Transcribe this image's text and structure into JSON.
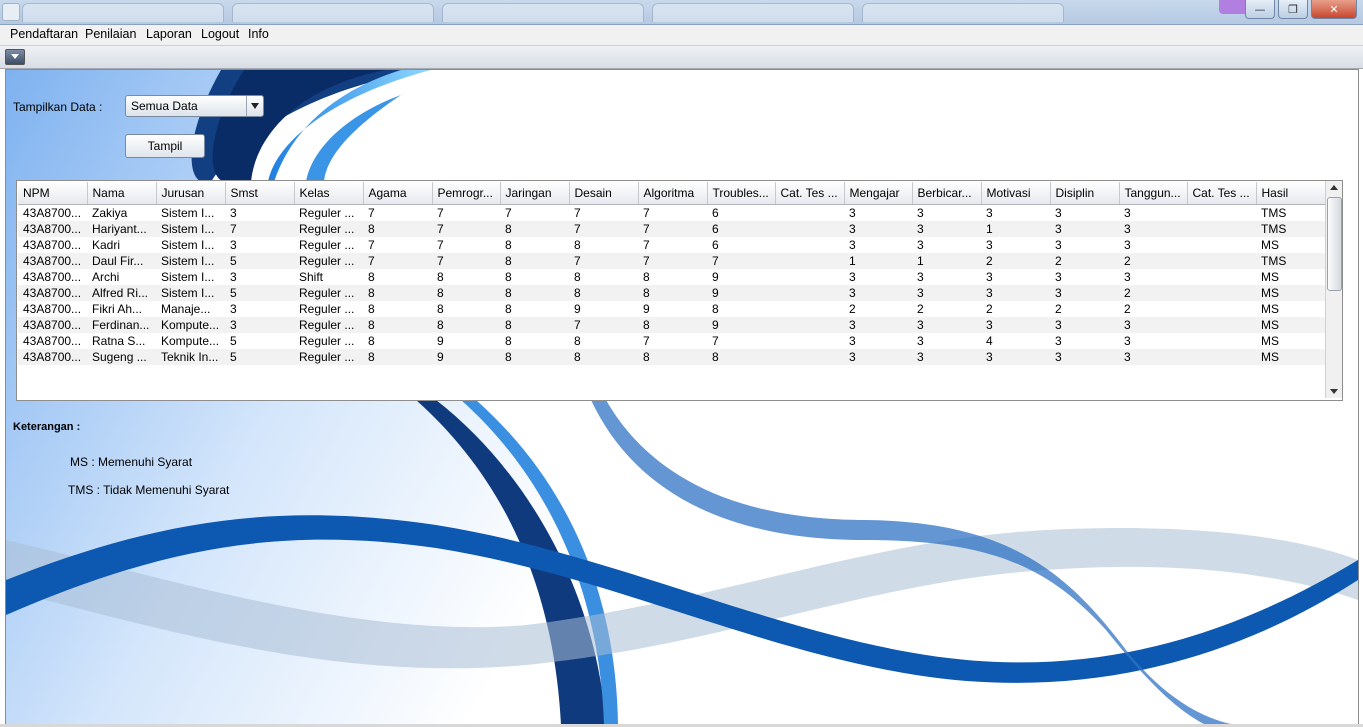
{
  "menu": {
    "items": [
      "Pendaftaran",
      "Penilaian",
      "Laporan",
      "Logout",
      "Info"
    ]
  },
  "filter": {
    "label": "Tampilkan Data :",
    "selected": "Semua Data",
    "button_label": "Tampil"
  },
  "table": {
    "columns": [
      "NPM",
      "Nama",
      "Jurusan",
      "Smst",
      "Kelas",
      "Agama",
      "Pemrogr...",
      "Jaringan",
      "Desain",
      "Algoritma",
      "Troubles...",
      "Cat. Tes ...",
      "Mengajar",
      "Berbicar...",
      "Motivasi",
      "Disiplin",
      "Tanggun...",
      "Cat. Tes ...",
      "Hasil"
    ],
    "rows": [
      [
        "43A8700...",
        "Zakiya",
        "Sistem I...",
        "3",
        "Reguler ...",
        "7",
        "7",
        "7",
        "7",
        "7",
        "6",
        "",
        "3",
        "3",
        "3",
        "3",
        "3",
        "",
        "TMS"
      ],
      [
        "43A8700...",
        "Hariyant...",
        "Sistem I...",
        "7",
        "Reguler ...",
        "8",
        "7",
        "8",
        "7",
        "7",
        "6",
        "",
        "3",
        "3",
        "1",
        "3",
        "3",
        "",
        "TMS"
      ],
      [
        "43A8700...",
        "Kadri",
        "Sistem I...",
        "3",
        "Reguler ...",
        "7",
        "7",
        "8",
        "8",
        "7",
        "6",
        "",
        "3",
        "3",
        "3",
        "3",
        "3",
        "",
        "MS"
      ],
      [
        "43A8700...",
        "Daul Fir...",
        "Sistem I...",
        "5",
        "Reguler ...",
        "7",
        "7",
        "8",
        "7",
        "7",
        "7",
        "",
        "1",
        "1",
        "2",
        "2",
        "2",
        "",
        "TMS"
      ],
      [
        "43A8700...",
        "Archi",
        "Sistem I...",
        "3",
        "Shift",
        "8",
        "8",
        "8",
        "8",
        "8",
        "9",
        "",
        "3",
        "3",
        "3",
        "3",
        "3",
        "",
        "MS"
      ],
      [
        "43A8700...",
        "Alfred Ri...",
        "Sistem I...",
        "5",
        "Reguler ...",
        "8",
        "8",
        "8",
        "8",
        "8",
        "9",
        "",
        "3",
        "3",
        "3",
        "3",
        "2",
        "",
        "MS"
      ],
      [
        "43A8700...",
        "Fikri Ah...",
        "Manaje...",
        "3",
        "Reguler ...",
        "8",
        "8",
        "8",
        "9",
        "9",
        "8",
        "",
        "2",
        "2",
        "2",
        "2",
        "2",
        "",
        "MS"
      ],
      [
        "43A8700...",
        "Ferdinan...",
        "Kompute...",
        "3",
        "Reguler ...",
        "8",
        "8",
        "8",
        "7",
        "8",
        "9",
        "",
        "3",
        "3",
        "3",
        "3",
        "3",
        "",
        "MS"
      ],
      [
        "43A8700...",
        "Ratna S...",
        "Kompute...",
        "5",
        "Reguler ...",
        "8",
        "9",
        "8",
        "8",
        "7",
        "7",
        "",
        "3",
        "3",
        "4",
        "3",
        "3",
        "",
        "MS"
      ],
      [
        "43A8700...",
        "Sugeng ...",
        "Teknik In...",
        "5",
        "Reguler ...",
        "8",
        "9",
        "8",
        "8",
        "8",
        "8",
        "",
        "3",
        "3",
        "3",
        "3",
        "3",
        "",
        "MS"
      ]
    ]
  },
  "legend": {
    "heading": "Keterangan :",
    "ms": "MS : Memenuhi Syarat",
    "tms": "TMS : Tidak Memenuhi Syarat"
  }
}
